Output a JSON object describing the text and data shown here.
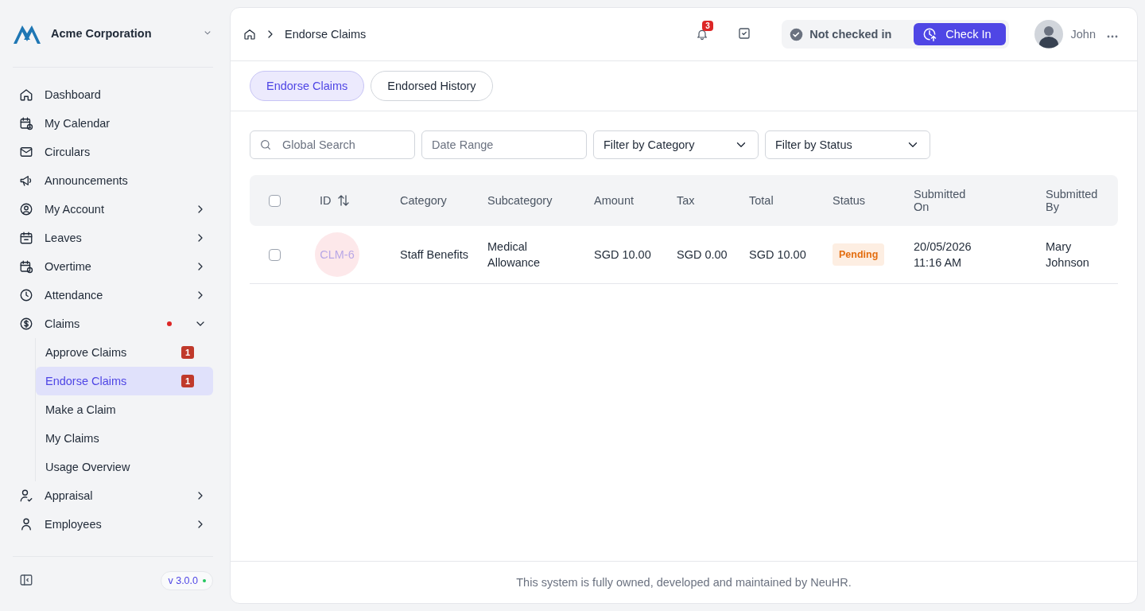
{
  "sidebar": {
    "company": "Acme Corporation",
    "items": [
      {
        "label": "Dashboard",
        "kind": "link"
      },
      {
        "label": "My Calendar",
        "kind": "link"
      },
      {
        "label": "Circulars",
        "kind": "link"
      },
      {
        "label": "Announcements",
        "kind": "link"
      },
      {
        "label": "My Account",
        "kind": "group",
        "expanded": false,
        "alert": false
      },
      {
        "label": "Leaves",
        "kind": "group",
        "expanded": false,
        "alert": false
      },
      {
        "label": "Overtime",
        "kind": "group",
        "expanded": false,
        "alert": false
      },
      {
        "label": "Attendance",
        "kind": "group",
        "expanded": false,
        "alert": false
      },
      {
        "label": "Claims",
        "kind": "group",
        "expanded": true,
        "alert": true,
        "children": [
          {
            "label": "Approve Claims",
            "badge": "1",
            "selected": false
          },
          {
            "label": "Endorse Claims",
            "badge": "1",
            "selected": true
          },
          {
            "label": "Make a Claim",
            "selected": false
          },
          {
            "label": "My Claims",
            "selected": false
          },
          {
            "label": "Usage Overview",
            "selected": false
          }
        ]
      },
      {
        "label": "Appraisal",
        "kind": "group",
        "expanded": false,
        "alert": false
      },
      {
        "label": "Employees",
        "kind": "group",
        "expanded": false,
        "alert": false
      }
    ],
    "version": "v 3.0.0"
  },
  "header": {
    "breadcrumb": "Endorse Claims",
    "notifications": "3",
    "check_status": "Not checked in",
    "check_in_button": "Check In",
    "user": "John"
  },
  "tabs": [
    {
      "label": "Endorse Claims",
      "selected": true
    },
    {
      "label": "Endorsed History",
      "selected": false
    }
  ],
  "filters": {
    "search": {
      "placeholder": "Global Search"
    },
    "date": {
      "placeholder": "Date Range"
    },
    "category": "Filter by Category",
    "status": "Filter by Status"
  },
  "table": {
    "all_selected": false,
    "columns": [
      "ID",
      "Category",
      "Subcategory",
      "Amount",
      "Tax",
      "Total",
      "Status",
      "Submitted On",
      "Submitted By"
    ],
    "rows": [
      {
        "checked": false,
        "id": "CLM-6",
        "category": "Staff Benefits",
        "subcategory": "Medical Allowance",
        "amount": "SGD 10.00",
        "tax": "SGD 0.00",
        "total": "SGD 10.00",
        "status": "Pending",
        "submitted_on": "20/05/2026 11:16 AM",
        "submitted_by": "Mary Johnson"
      }
    ]
  },
  "footer": "This system is fully owned, developed and maintained by NeuHR."
}
